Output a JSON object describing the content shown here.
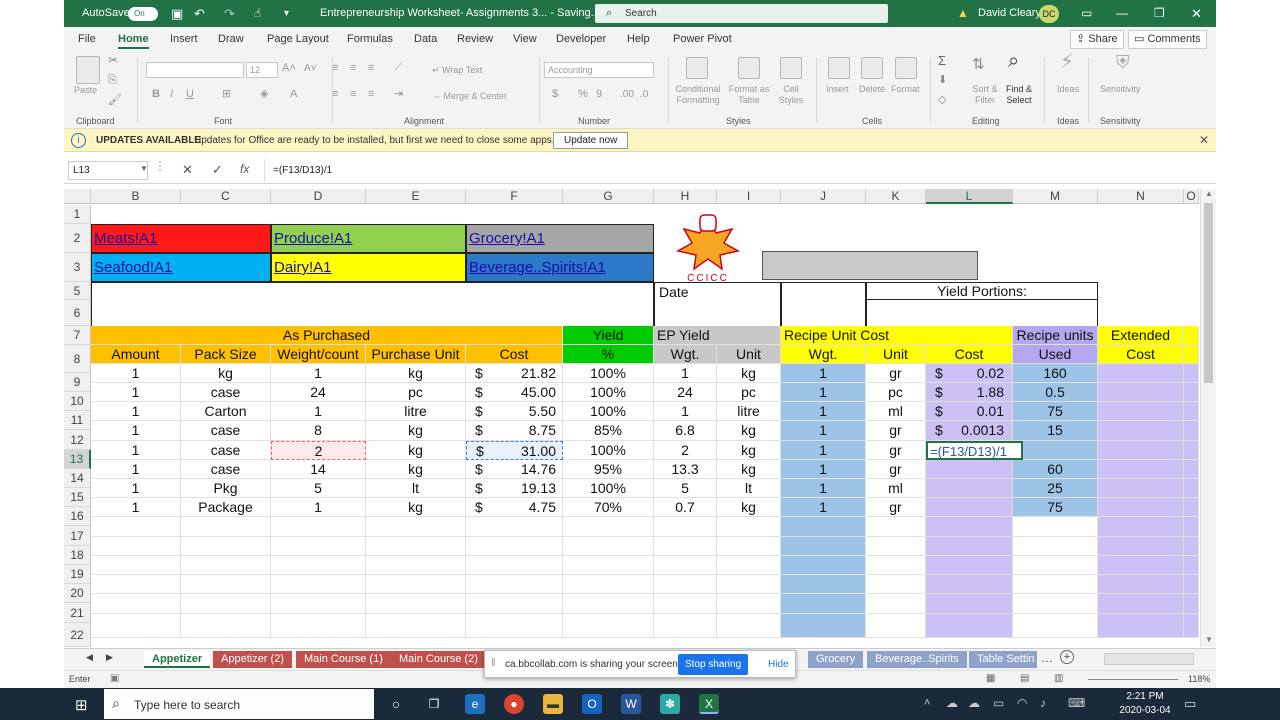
{
  "titlebar": {
    "autosave_label": "AutoSave",
    "autosave_state": "On",
    "document_title": "Entrepreneurship Worksheet- Assignments 3...  -  Saving...  ▾",
    "search_placeholder": "Search",
    "user_name": "David Cleary",
    "user_initials": "DC"
  },
  "menu": {
    "items": [
      "File",
      "Home",
      "Insert",
      "Draw",
      "Page Layout",
      "Formulas",
      "Data",
      "Review",
      "View",
      "Developer",
      "Help",
      "Power Pivot"
    ],
    "active": "Home",
    "share_label": "Share",
    "comments_label": "Comments"
  },
  "ribbon": {
    "paste_label": "Paste",
    "font_size": "12",
    "wrap_text_label": "Wrap Text",
    "merge_label": "Merge & Center",
    "number_format": "Accounting",
    "conditional_label": "Conditional",
    "formatting_label": "Formatting",
    "format_as_label": "Format as",
    "table_label": "Table",
    "cell_label": "Cell",
    "styles_btn_label": "Styles",
    "insert_label": "Insert",
    "delete_label": "Delete",
    "format_label": "Format",
    "sort_label": "Sort &",
    "filter_label": "Filter",
    "find_label": "Find &",
    "select_label": "Select",
    "ideas_label": "Ideas",
    "sensitivity_label": "Sensitivity",
    "groups": [
      "Clipboard",
      "Font",
      "Alignment",
      "Number",
      "Styles",
      "Cells",
      "Editing",
      "Ideas",
      "Sensitivity"
    ]
  },
  "update_bar": {
    "title": "UPDATES AVAILABLE",
    "message": "Updates for Office are ready to be installed, but first we need to close some apps.",
    "button_label": "Update now"
  },
  "formula_bar": {
    "name_box": "L13",
    "fx_label": "fx",
    "formula": "=(F13/D13)/1"
  },
  "columns": [
    "B",
    "C",
    "D",
    "E",
    "F",
    "G",
    "H",
    "I",
    "J",
    "K",
    "L",
    "M",
    "N",
    "O"
  ],
  "selected_column": "L",
  "rows": [
    "1",
    "2",
    "3",
    "5",
    "6",
    "7",
    "8",
    "9",
    "10",
    "11",
    "12",
    "13",
    "14",
    "15",
    "16",
    "17",
    "18",
    "19",
    "20",
    "21",
    "22"
  ],
  "selected_row": "13",
  "links": {
    "meats": "Meats!A1",
    "produce": "Produce!A1",
    "grocery": "Grocery!A1",
    "seafood": "Seafood!A1",
    "dairy": "Dairy!A1",
    "beverage": "Beverage..Spirits!A1"
  },
  "logo_text": "CCICC",
  "labels": {
    "date": "Date",
    "yield_portions": "Yield Portions:",
    "as_purchased": "As Purchased",
    "yield": "Yield",
    "ep_yield": "EP Yield",
    "recipe_unit_cost": "Recipe Unit Cost",
    "recipe_units": "Recipe units",
    "extended": "Extended"
  },
  "headers": {
    "amount": "Amount",
    "pack_size": "Pack Size",
    "weight_count": "Weight/count",
    "purchase_unit": "Purchase Unit",
    "cost": "Cost",
    "yield_pct": "%",
    "wgt": "Wgt.",
    "unit": "Unit",
    "wgt2": "Wgt.",
    "unit2": "Unit",
    "cost2": "Cost",
    "used": "Used",
    "ext_cost": "Cost"
  },
  "table": [
    {
      "amount": "1",
      "pack": "kg",
      "weight": "1",
      "punit": "kg",
      "cost": "21.82",
      "yield": "100%",
      "ep_wgt": "1",
      "ep_unit": "kg",
      "r_wgt": "1",
      "r_unit": "gr",
      "r_cost": "0.02",
      "used": "160"
    },
    {
      "amount": "1",
      "pack": "case",
      "weight": "24",
      "punit": "pc",
      "cost": "45.00",
      "yield": "100%",
      "ep_wgt": "24",
      "ep_unit": "pc",
      "r_wgt": "1",
      "r_unit": "pc",
      "r_cost": "1.88",
      "used": "0.5"
    },
    {
      "amount": "1",
      "pack": "Carton",
      "weight": "1",
      "punit": "litre",
      "cost": "5.50",
      "yield": "100%",
      "ep_wgt": "1",
      "ep_unit": "litre",
      "r_wgt": "1",
      "r_unit": "ml",
      "r_cost": "0.01",
      "used": "75"
    },
    {
      "amount": "1",
      "pack": "case",
      "weight": "8",
      "punit": "kg",
      "cost": "8.75",
      "yield": "85%",
      "ep_wgt": "6.8",
      "ep_unit": "kg",
      "r_wgt": "1",
      "r_unit": "gr",
      "r_cost": "0.0013",
      "used": "15"
    },
    {
      "amount": "1",
      "pack": "case",
      "weight": "2",
      "punit": "kg",
      "cost": "31.00",
      "yield": "100%",
      "ep_wgt": "2",
      "ep_unit": "kg",
      "r_wgt": "1",
      "r_unit": "gr",
      "r_cost": "=(F13/D13)/1",
      "used": ""
    },
    {
      "amount": "1",
      "pack": "case",
      "weight": "14",
      "punit": "kg",
      "cost": "14.76",
      "yield": "95%",
      "ep_wgt": "13.3",
      "ep_unit": "kg",
      "r_wgt": "1",
      "r_unit": "gr",
      "r_cost": "",
      "used": "60"
    },
    {
      "amount": "1",
      "pack": "Pkg",
      "weight": "5",
      "punit": "lt",
      "cost": "19.13",
      "yield": "100%",
      "ep_wgt": "5",
      "ep_unit": "lt",
      "r_wgt": "1",
      "r_unit": "ml",
      "r_cost": "",
      "used": "25"
    },
    {
      "amount": "1",
      "pack": "Package",
      "weight": "1",
      "punit": "kg",
      "cost": "4.75",
      "yield": "70%",
      "ep_wgt": "0.7",
      "ep_unit": "kg",
      "r_wgt": "1",
      "r_unit": "gr",
      "r_cost": "",
      "used": "75"
    }
  ],
  "currency": "$",
  "sheet_tabs": [
    "Appetizer",
    "Appetizer (2)",
    "Main Course (1)",
    "Main Course (2)",
    "Grocery",
    "Beverage..Spirits",
    "Table Settin"
  ],
  "active_tab": "Appetizer",
  "sharing": {
    "message": "ca.bbcollab.com is sharing your screen.",
    "stop_label": "Stop sharing",
    "hide_label": "Hide"
  },
  "status": {
    "mode": "Enter",
    "zoom": "118%"
  },
  "taskbar": {
    "search_placeholder": "Type here to search",
    "time": "2:21 PM",
    "date": "2020-03-04"
  }
}
